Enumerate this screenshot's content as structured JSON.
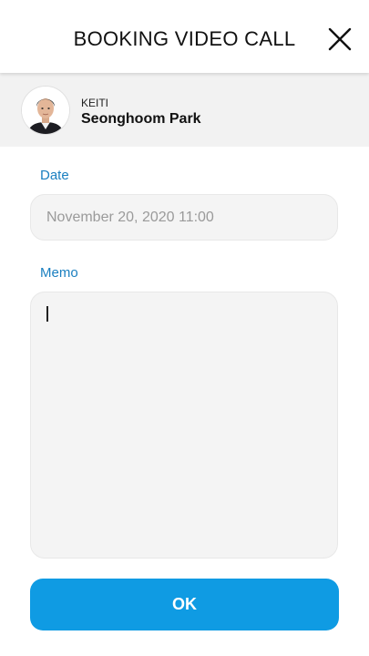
{
  "header": {
    "title": "BOOKING VIDEO CALL"
  },
  "profile": {
    "organization": "KEITI",
    "name": "Seonghoom Park"
  },
  "form": {
    "date_label": "Date",
    "date_value": "November 20, 2020 11:00",
    "memo_label": "Memo",
    "memo_value": ""
  },
  "actions": {
    "ok_label": "OK"
  },
  "colors": {
    "accent": "#0f9be3",
    "label": "#1a7fc0",
    "field_bg": "#f4f4f4",
    "profile_bg": "#f2f2f2"
  },
  "icons": {
    "close": "close-icon",
    "avatar": "person-avatar"
  }
}
